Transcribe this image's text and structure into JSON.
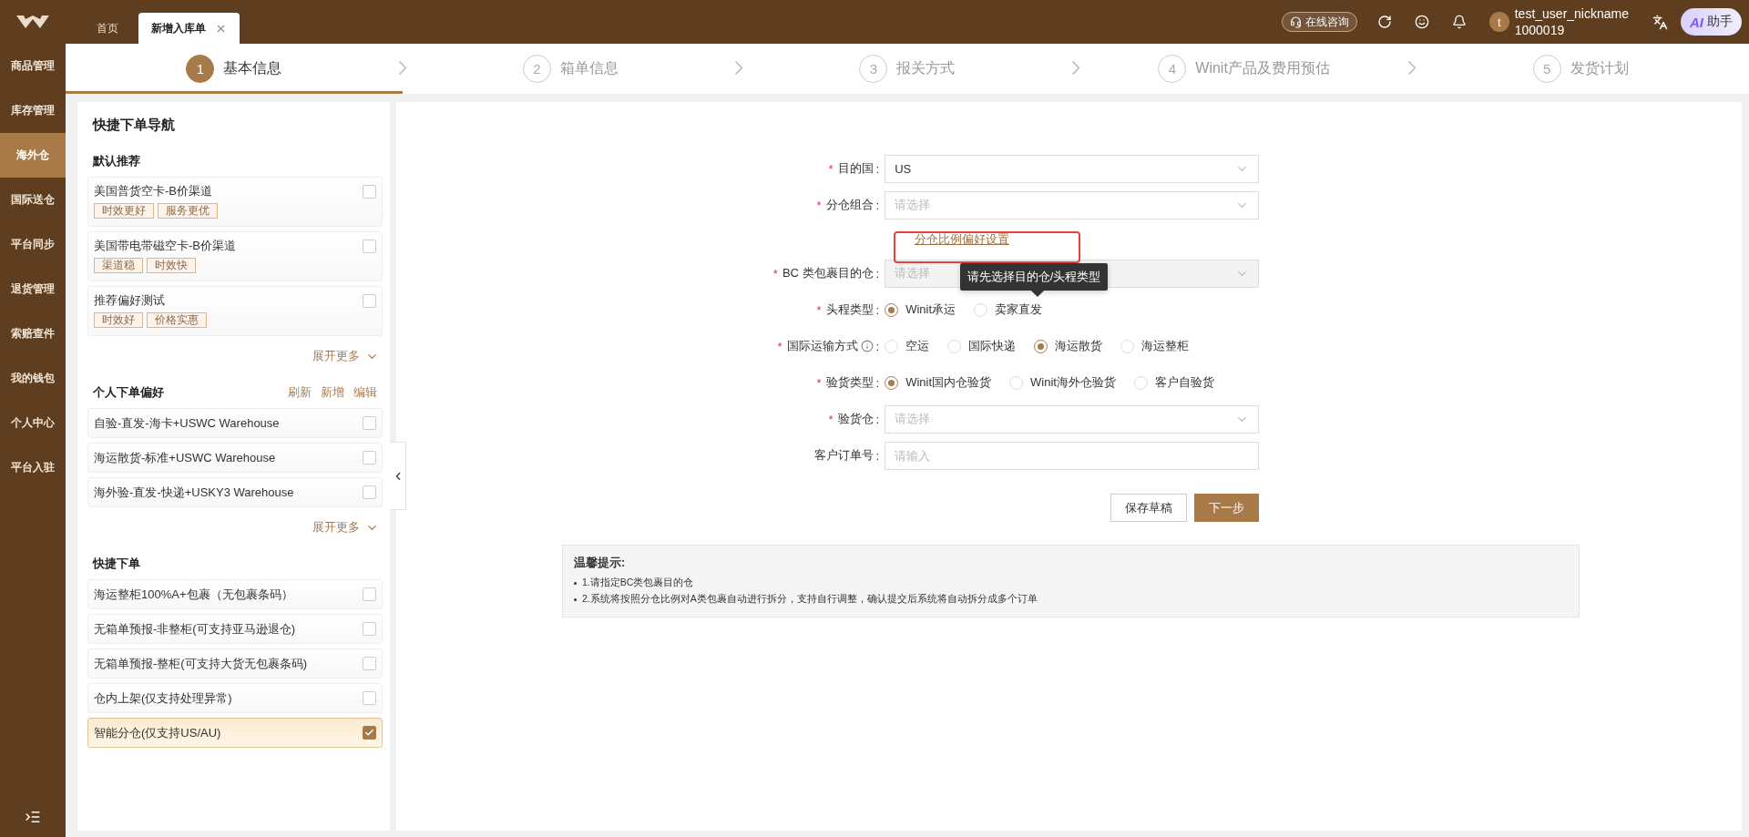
{
  "top_bar": {
    "tabs": [
      {
        "label": "首页",
        "selected": false,
        "closable": false
      },
      {
        "label": "新增入库单",
        "selected": true,
        "closable": true
      }
    ],
    "consult_button": "在线咨询",
    "user": {
      "avatar_letter": "t",
      "name": "test_user_nickname",
      "id": "1000019"
    },
    "assistant_button": {
      "badge": "AI",
      "label": "助手"
    }
  },
  "sidebar": {
    "items": [
      {
        "label": "商品管理",
        "selected": false
      },
      {
        "label": "库存管理",
        "selected": false
      },
      {
        "label": "海外仓",
        "selected": true
      },
      {
        "label": "国际送仓",
        "selected": false
      },
      {
        "label": "平台同步",
        "selected": false
      },
      {
        "label": "退货管理",
        "selected": false
      },
      {
        "label": "索赔查件",
        "selected": false
      },
      {
        "label": "我的钱包",
        "selected": false
      },
      {
        "label": "个人中心",
        "selected": false
      },
      {
        "label": "平台入驻",
        "selected": false
      }
    ]
  },
  "steps": [
    {
      "number": "1",
      "label": "基本信息",
      "selected": true
    },
    {
      "number": "2",
      "label": "箱单信息",
      "selected": false
    },
    {
      "number": "3",
      "label": "报关方式",
      "selected": false
    },
    {
      "number": "4",
      "label": "Winit产品及费用预估",
      "selected": false
    },
    {
      "number": "5",
      "label": "发货计划",
      "selected": false
    }
  ],
  "nav_panel": {
    "title": "快捷下单导航",
    "recommended": {
      "title": "默认推荐",
      "items": [
        {
          "name": "美国普货空卡-B价渠道",
          "tags": [
            "时效更好",
            "服务更优"
          ],
          "checked": false
        },
        {
          "name": "美国带电带磁空卡-B价渠道",
          "tags": [
            "渠道稳",
            "时效快"
          ],
          "checked": false
        },
        {
          "name": "推荐偏好测试",
          "tags": [
            "时效好",
            "价格实惠"
          ],
          "checked": false
        }
      ],
      "more": "展开更多"
    },
    "preferences": {
      "title": "个人下单偏好",
      "actions": [
        "刷新",
        "新增",
        "编辑"
      ],
      "items": [
        {
          "name": "自验-直发-海卡+USWC Warehouse",
          "checked": false
        },
        {
          "name": "海运散货-标准+USWC Warehouse",
          "checked": false
        },
        {
          "name": "海外验-直发-快递+USKY3 Warehouse",
          "checked": false
        }
      ],
      "more": "展开更多"
    },
    "quick": {
      "title": "快捷下单",
      "items": [
        {
          "name": "海运整柜100%A+包裹（无包裹条码）",
          "checked": false
        },
        {
          "name": "无箱单预报-非整柜(可支持亚马逊退仓)",
          "checked": false
        },
        {
          "name": "无箱单预报-整柜(可支持大货无包裹条码)",
          "checked": false
        },
        {
          "name": "仓内上架(仅支持处理异常)",
          "checked": false
        },
        {
          "name": "智能分仓(仅支持US/AU)",
          "checked": true
        }
      ]
    }
  },
  "form": {
    "required_mark": "*",
    "label_colon": ":",
    "fields": [
      {
        "kind": "select",
        "label": "目的国",
        "required": true,
        "value": "US",
        "disabled": false
      },
      {
        "kind": "select",
        "label": "分仓组合",
        "required": true,
        "placeholder": "请选择",
        "disabled": false
      },
      {
        "kind": "link",
        "label": "分仓比例偏好设置",
        "highlighted": true,
        "tooltip": "请先选择目的仓/头程类型"
      },
      {
        "kind": "select",
        "label": "BC 类包裹目的仓",
        "required": true,
        "placeholder": "请选择",
        "disabled": true
      },
      {
        "kind": "radio",
        "label": "头程类型",
        "required": true,
        "options": [
          {
            "label": "Winit承运",
            "selected": true
          },
          {
            "label": "卖家直发",
            "selected": false
          }
        ]
      },
      {
        "kind": "radio",
        "label": "国际运输方式",
        "required": true,
        "info": true,
        "options": [
          {
            "label": "空运",
            "selected": false
          },
          {
            "label": "国际快递",
            "selected": false
          },
          {
            "label": "海运散货",
            "selected": true
          },
          {
            "label": "海运整柜",
            "selected": false
          }
        ]
      },
      {
        "kind": "radio",
        "label": "验货类型",
        "required": true,
        "options": [
          {
            "label": "Winit国内仓验货",
            "selected": true
          },
          {
            "label": "Winit海外仓验货",
            "selected": false
          },
          {
            "label": "客户自验货",
            "selected": false
          }
        ]
      },
      {
        "kind": "select",
        "label": "验货仓",
        "required": true,
        "placeholder": "请选择",
        "disabled": false
      },
      {
        "kind": "input",
        "label": "客户订单号",
        "placeholder": "请输入"
      }
    ],
    "buttons": [
      {
        "label": "保存草稿",
        "primary": false
      },
      {
        "label": "下一步",
        "primary": true
      }
    ]
  },
  "tips": {
    "title": "温馨提示:",
    "items": [
      "1.请指定BC类包裹目的仓",
      "2.系统将按照分仓比例对A类包裹自动进行拆分，支持自行调整，确认提交后系统将自动拆分成多个订单"
    ]
  }
}
